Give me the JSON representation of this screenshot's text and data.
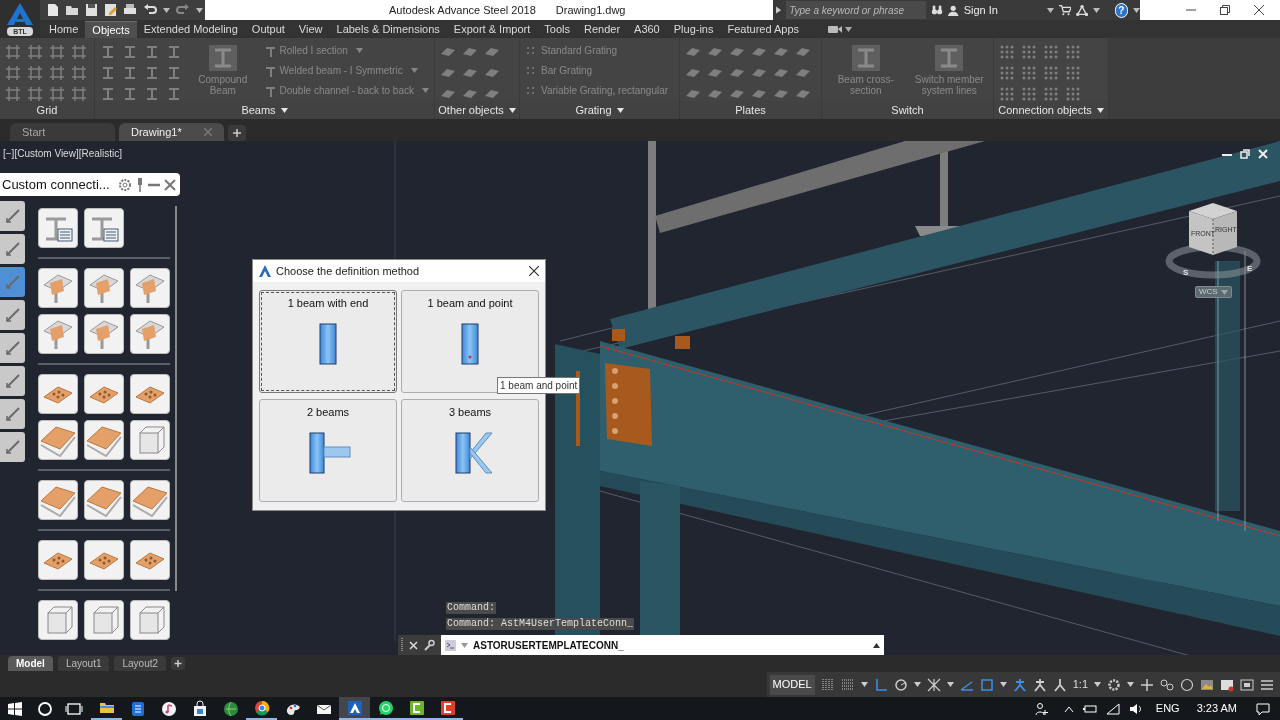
{
  "app_button": {
    "label": "BTL"
  },
  "title_bar": {
    "title": "Autodesk Advance Steel 2018",
    "document": "Drawing1.dwg",
    "search": {
      "placeholder": "Type a keyword or phrase"
    },
    "sign_in": "Sign In",
    "help": "?"
  },
  "ribbon": {
    "disabled": true,
    "tabs": [
      {
        "label": "Home",
        "selected": false
      },
      {
        "label": "Objects",
        "selected": true
      },
      {
        "label": "Extended Modeling",
        "selected": false
      },
      {
        "label": "Output",
        "selected": false
      },
      {
        "label": "View",
        "selected": false
      },
      {
        "label": "Labels & Dimensions",
        "selected": false
      },
      {
        "label": "Export & Import",
        "selected": false
      },
      {
        "label": "Tools",
        "selected": false
      },
      {
        "label": "Render",
        "selected": false
      },
      {
        "label": "A360",
        "selected": false
      },
      {
        "label": "Plug-ins",
        "selected": false
      },
      {
        "label": "Featured Apps",
        "selected": false
      }
    ],
    "panels": [
      {
        "title": "Grid",
        "menu": false
      },
      {
        "title": "Beams",
        "menu": true,
        "items": [
          {
            "kind": "large",
            "label": "Compound Beam"
          },
          {
            "kind": "list",
            "label": "Rolled I section",
            "menu": true
          },
          {
            "kind": "list",
            "label": "Welded beam - I Symmetric",
            "menu": true
          },
          {
            "kind": "list",
            "label": "Double channel - back to back",
            "menu": true
          }
        ]
      },
      {
        "title": "Other objects",
        "menu": true
      },
      {
        "title": "Grating",
        "menu": true,
        "items": [
          {
            "kind": "list",
            "label": "Standard Grating",
            "menu": false
          },
          {
            "kind": "list",
            "label": "Bar Grating",
            "menu": false
          },
          {
            "kind": "list",
            "label": "Variable Grating, rectangular",
            "menu": false
          }
        ]
      },
      {
        "title": "Plates",
        "menu": false
      },
      {
        "title": "Switch",
        "menu": false,
        "items": [
          {
            "kind": "large",
            "label": "Beam cross-section"
          },
          {
            "kind": "large",
            "label": "Switch member system lines"
          }
        ]
      },
      {
        "title": "Connection objects",
        "menu": true
      }
    ]
  },
  "document_tabs": [
    {
      "label": "Start",
      "selected": false
    },
    {
      "label": "Drawing1*",
      "selected": true
    }
  ],
  "viewport": {
    "label": "[−][Custom View][Realistic]",
    "view_cube": {
      "faces": [
        "FRONT",
        "RIGHT"
      ],
      "compass": [
        "S",
        "E"
      ]
    },
    "ucs": "WCS"
  },
  "palette": {
    "title": "Custom connecti...",
    "tabs": [
      {
        "selected": false
      },
      {
        "selected": false
      },
      {
        "selected": true
      },
      {
        "selected": false
      },
      {
        "selected": false
      },
      {
        "selected": false
      },
      {
        "selected": false
      },
      {
        "selected": false
      }
    ]
  },
  "dialog": {
    "title": "Choose the definition method",
    "options": [
      {
        "kind": "beam_end",
        "label": "1 beam with end",
        "focused": true
      },
      {
        "kind": "beam_point",
        "label": "1 beam and point",
        "focused": false
      },
      {
        "kind": "two_beams",
        "label": "2 beams",
        "focused": false
      },
      {
        "kind": "three_beams",
        "label": "3 beams",
        "focused": false
      }
    ]
  },
  "tooltip": "1 beam and point",
  "command": {
    "history": [
      "Command:",
      "Command: AstM4UserTemplateConn_"
    ],
    "input": "ASTORUSERTEMPLATECONN_"
  },
  "layout_tabs": [
    {
      "label": "Model",
      "selected": true
    },
    {
      "label": "Layout1",
      "selected": false
    },
    {
      "label": "Layout2",
      "selected": false
    }
  ],
  "status_bar": {
    "space": "MODEL",
    "scale": "1:1"
  },
  "taskbar": {
    "apps": [
      {
        "kind": "folder",
        "running": true,
        "active": false
      },
      {
        "kind": "tile",
        "running": false,
        "active": false
      },
      {
        "kind": "music",
        "running": false,
        "active": false
      },
      {
        "kind": "bag",
        "running": false,
        "active": false
      },
      {
        "kind": "globe",
        "running": false,
        "active": false
      },
      {
        "kind": "wheel",
        "running": true,
        "active": false
      },
      {
        "kind": "paint",
        "running": false,
        "active": false
      },
      {
        "kind": "mail",
        "running": false,
        "active": false
      },
      {
        "kind": "steel",
        "running": true,
        "active": true
      },
      {
        "kind": "chat",
        "running": true,
        "active": false
      },
      {
        "kind": "green_square",
        "running": true,
        "active": false
      },
      {
        "kind": "red_square",
        "running": true,
        "active": false
      }
    ],
    "language": "ENG",
    "time": "3:23 AM"
  }
}
